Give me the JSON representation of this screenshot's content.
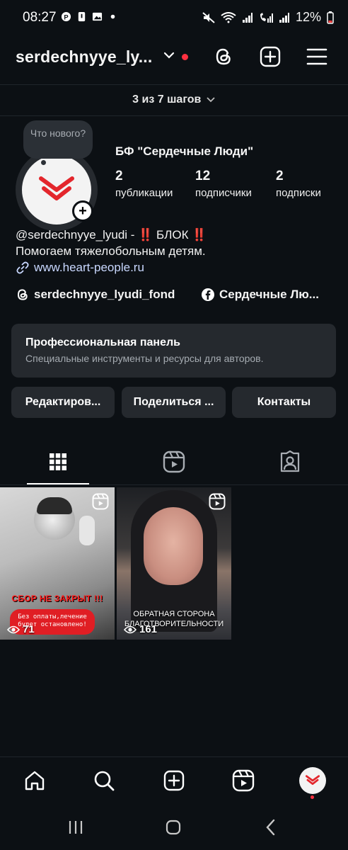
{
  "status_bar": {
    "time": "08:27",
    "battery": "12%",
    "left_icons": [
      "pinterest-icon",
      "notification-icon",
      "gallery-icon",
      "dot-icon"
    ],
    "right_icons": [
      "mute-icon",
      "wifi-icon",
      "signal-icon",
      "call-signal-icon",
      "signal-icon",
      "battery-icon"
    ]
  },
  "header": {
    "username": "serdechnyye_ly...",
    "icons": [
      "threads-icon",
      "create-icon",
      "menu-icon"
    ],
    "accent": "#ff3040"
  },
  "steps": {
    "label": "3 из 7 шагов"
  },
  "profile": {
    "note_text": "Что нового?",
    "display_name": "БФ \"Сердечные Люди\"",
    "stats": [
      {
        "value": "2",
        "label": "публикации"
      },
      {
        "value": "12",
        "label": "подписчики"
      },
      {
        "value": "2",
        "label": "подписки"
      }
    ],
    "bio_line1": "@serdechnyye_lyudi - ‼️ БЛОК ‼️",
    "bio_line2": "Помогаем тяжелобольным детям.",
    "link": "www.heart-people.ru",
    "threads_account": "serdechnyye_lyudi_fond",
    "facebook_account": "Сердечные Лю..."
  },
  "pro_panel": {
    "title": "Профессиональная панель",
    "subtitle": "Специальные инструменты и ресурсы для авторов."
  },
  "buttons": {
    "edit": "Редактиров...",
    "share": "Поделиться ...",
    "contacts": "Контакты"
  },
  "tabs": [
    "grid-icon",
    "reels-icon",
    "tagged-icon"
  ],
  "posts": [
    {
      "caption": "СБОР НЕ ЗАКРЫТ !!!",
      "pill_text": "Без оплаты,лечение будет остановлено!",
      "views": "71"
    },
    {
      "caption": "ОБРАТНАЯ СТОРОНА БЛАГОТВОРИТЕЛЬНОСТИ",
      "views": "161"
    }
  ],
  "bottom_nav": [
    "home-icon",
    "search-icon",
    "create-icon",
    "reels-icon",
    "profile-avatar"
  ],
  "system_nav": [
    "recents-icon",
    "home-button-icon",
    "back-icon"
  ]
}
